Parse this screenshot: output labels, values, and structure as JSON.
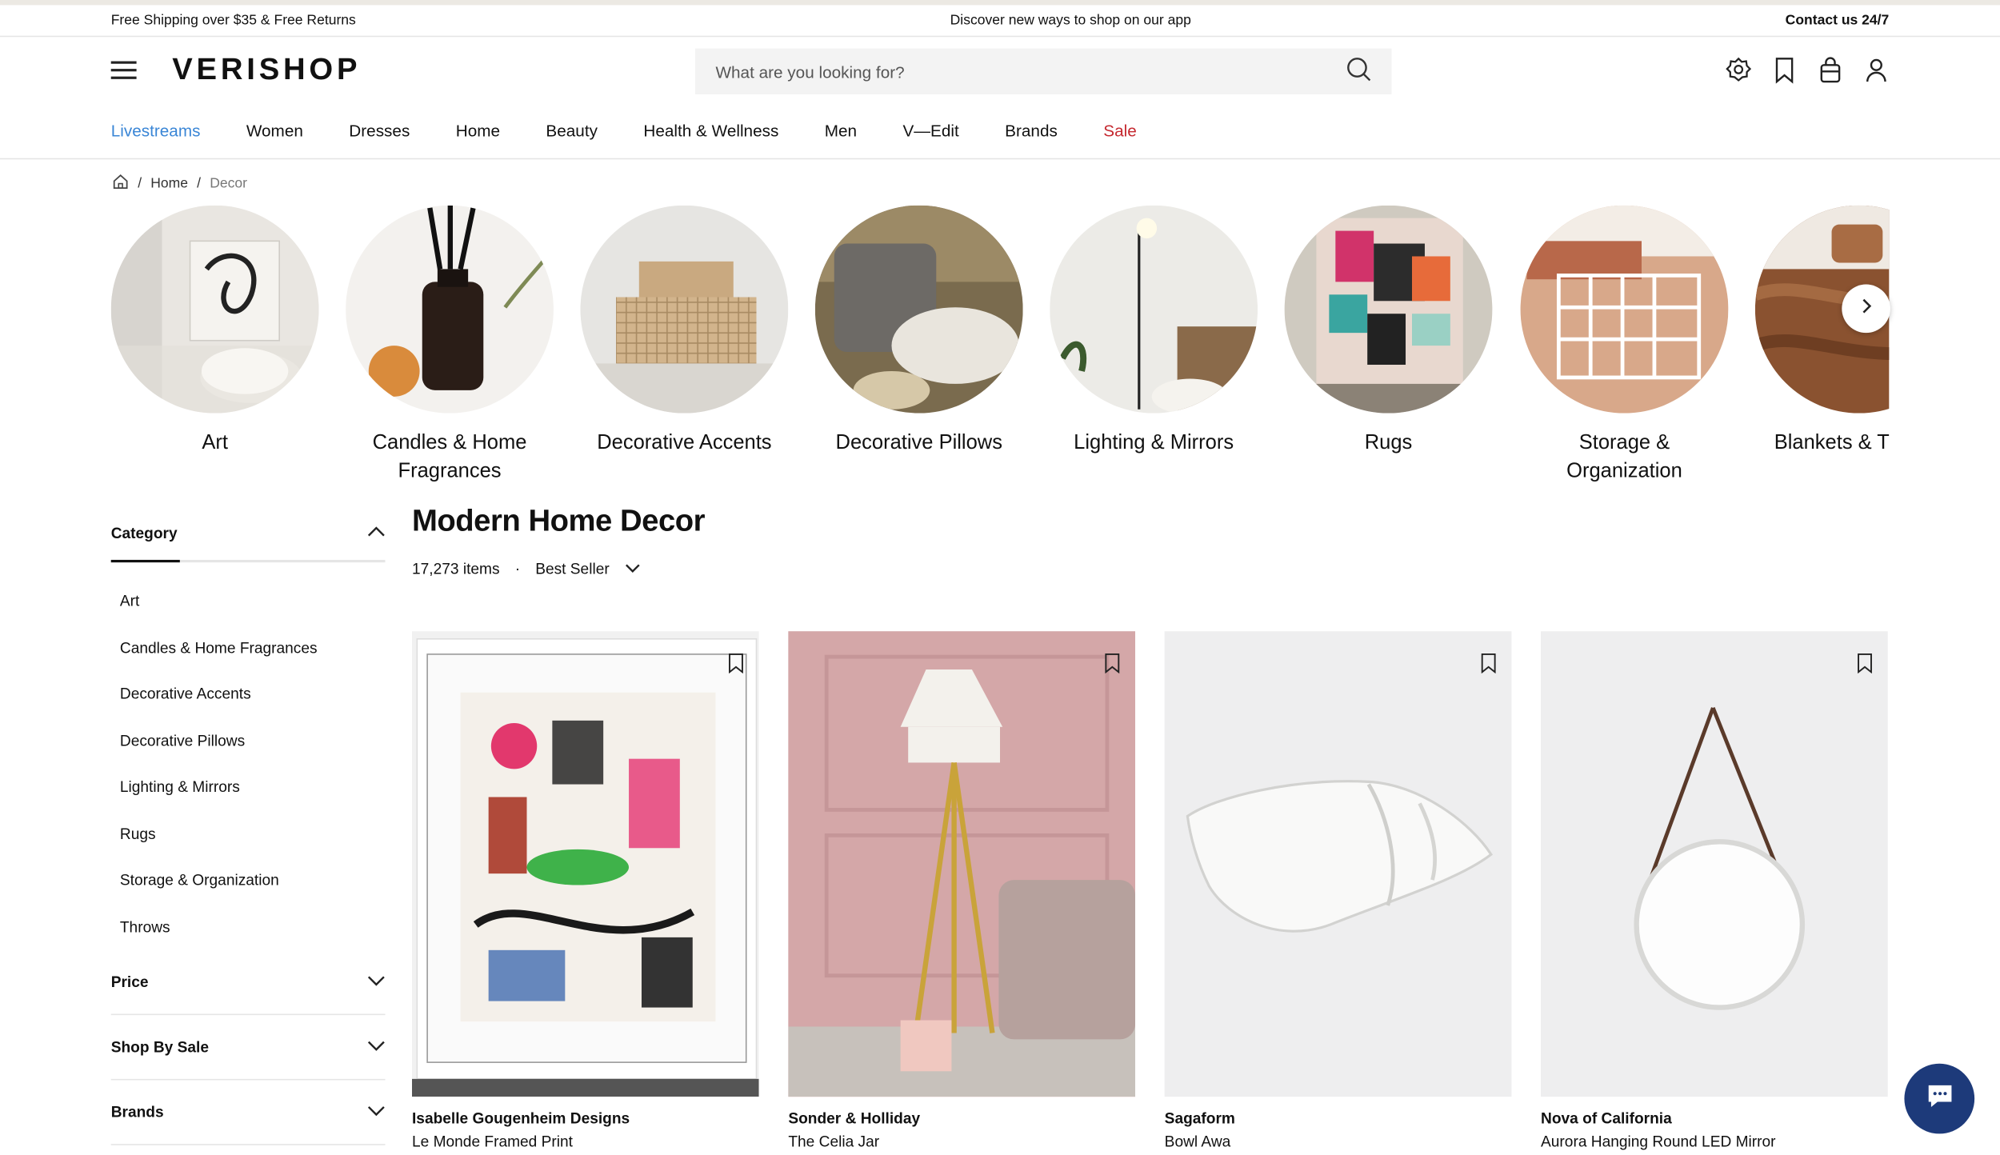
{
  "promo": {
    "left": "Free Shipping over $35 & Free Returns",
    "center": "Discover new ways to shop on our app",
    "right": "Contact us 24/7"
  },
  "header": {
    "logo": "VERISHOP",
    "search_placeholder": "What are you looking for?",
    "icons": [
      "menu-icon",
      "search-icon",
      "badge-icon",
      "bookmark-icon",
      "bag-icon",
      "account-icon"
    ]
  },
  "nav": [
    "Livestreams",
    "Women",
    "Dresses",
    "Home",
    "Beauty",
    "Health & Wellness",
    "Men",
    "V—Edit",
    "Brands",
    "Sale"
  ],
  "breadcrumb": {
    "items": [
      "Home",
      "Decor"
    ]
  },
  "categories": [
    "Art",
    "Candles & Home Fragrances",
    "Decorative Accents",
    "Decorative Pillows",
    "Lighting & Mirrors",
    "Rugs",
    "Storage & Organization",
    "Blankets & Throws"
  ],
  "sidebar": {
    "category_heading": "Category",
    "category_items": [
      "Art",
      "Candles & Home Fragrances",
      "Decorative Accents",
      "Decorative Pillows",
      "Lighting & Mirrors",
      "Rugs",
      "Storage & Organization",
      "Throws"
    ],
    "sections": [
      "Price",
      "Shop By Sale",
      "Brands"
    ]
  },
  "main": {
    "title": "Modern Home Decor",
    "count": "17,273 items",
    "sort": "Best Seller"
  },
  "products": [
    {
      "brand": "Isabelle Gougenheim Designs",
      "name": "Le Monde Framed Print"
    },
    {
      "brand": "Sonder & Holliday",
      "name": "The Celia Jar"
    },
    {
      "brand": "Sagaform",
      "name": "Bowl Awa"
    },
    {
      "brand": "Nova of California",
      "name": "Aurora Hanging Round LED Mirror"
    }
  ],
  "colors": {
    "accent_link": "#3a86d6",
    "sale": "#c5282f",
    "chat": "#1d3a7a"
  }
}
